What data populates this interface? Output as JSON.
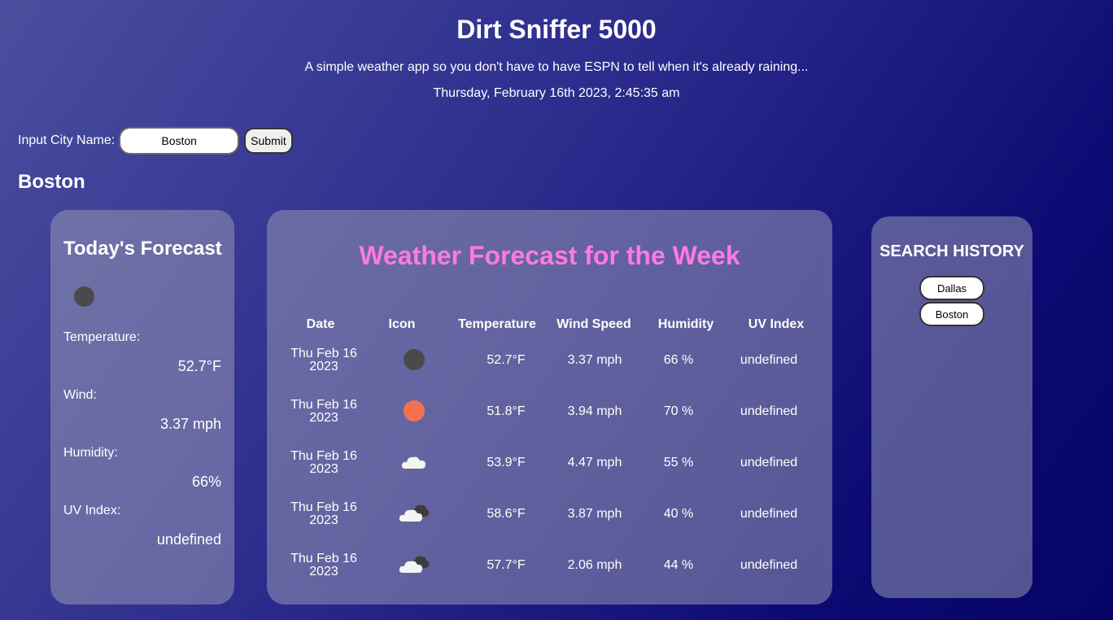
{
  "header": {
    "title": "Dirt Sniffer 5000",
    "subtitle": "A simple weather app so you don't have to have ESPN to tell when it's already raining...",
    "datetime": "Thursday, February 16th 2023, 2:45:35 am"
  },
  "search": {
    "label": "Input City Name:",
    "value": "Boston",
    "submit_label": "Submit"
  },
  "city_heading": "Boston",
  "today": {
    "title": "Today's Forecast",
    "icon": "overcast-dark-icon",
    "temperature_label": "Temperature:",
    "temperature": "52.7°F",
    "wind_label": "Wind:",
    "wind": "3.37 mph",
    "humidity_label": "Humidity:",
    "humidity": "66%",
    "uv_label": "UV Index:",
    "uv": "undefined"
  },
  "week": {
    "title": "Weather Forecast for the Week",
    "headers": [
      "Date",
      "Icon",
      "Temperature",
      "Wind Speed",
      "Humidity",
      "UV Index"
    ],
    "rows": [
      {
        "date_line1": "Thu Feb 16",
        "date_line2": "2023",
        "icon": "overcast-dark-icon",
        "temp": "52.7°F",
        "wind": "3.37 mph",
        "humidity": "66 %",
        "uv": "undefined"
      },
      {
        "date_line1": "Thu Feb 16",
        "date_line2": "2023",
        "icon": "clear-sun-icon",
        "temp": "51.8°F",
        "wind": "3.94 mph",
        "humidity": "70 %",
        "uv": "undefined"
      },
      {
        "date_line1": "Thu Feb 16",
        "date_line2": "2023",
        "icon": "cloud-icon",
        "temp": "53.9°F",
        "wind": "4.47 mph",
        "humidity": "55 %",
        "uv": "undefined"
      },
      {
        "date_line1": "Thu Feb 16",
        "date_line2": "2023",
        "icon": "broken-clouds-icon",
        "temp": "58.6°F",
        "wind": "3.87 mph",
        "humidity": "40 %",
        "uv": "undefined"
      },
      {
        "date_line1": "Thu Feb 16",
        "date_line2": "2023",
        "icon": "broken-clouds-icon",
        "temp": "57.7°F",
        "wind": "2.06 mph",
        "humidity": "44 %",
        "uv": "undefined"
      }
    ]
  },
  "history": {
    "title": "SEARCH HISTORY",
    "items": [
      "Dallas",
      "Boston"
    ]
  },
  "colors": {
    "accent_title": "#ff7adf",
    "sun": "#f4714f",
    "overcast": "#4a4a4a"
  }
}
